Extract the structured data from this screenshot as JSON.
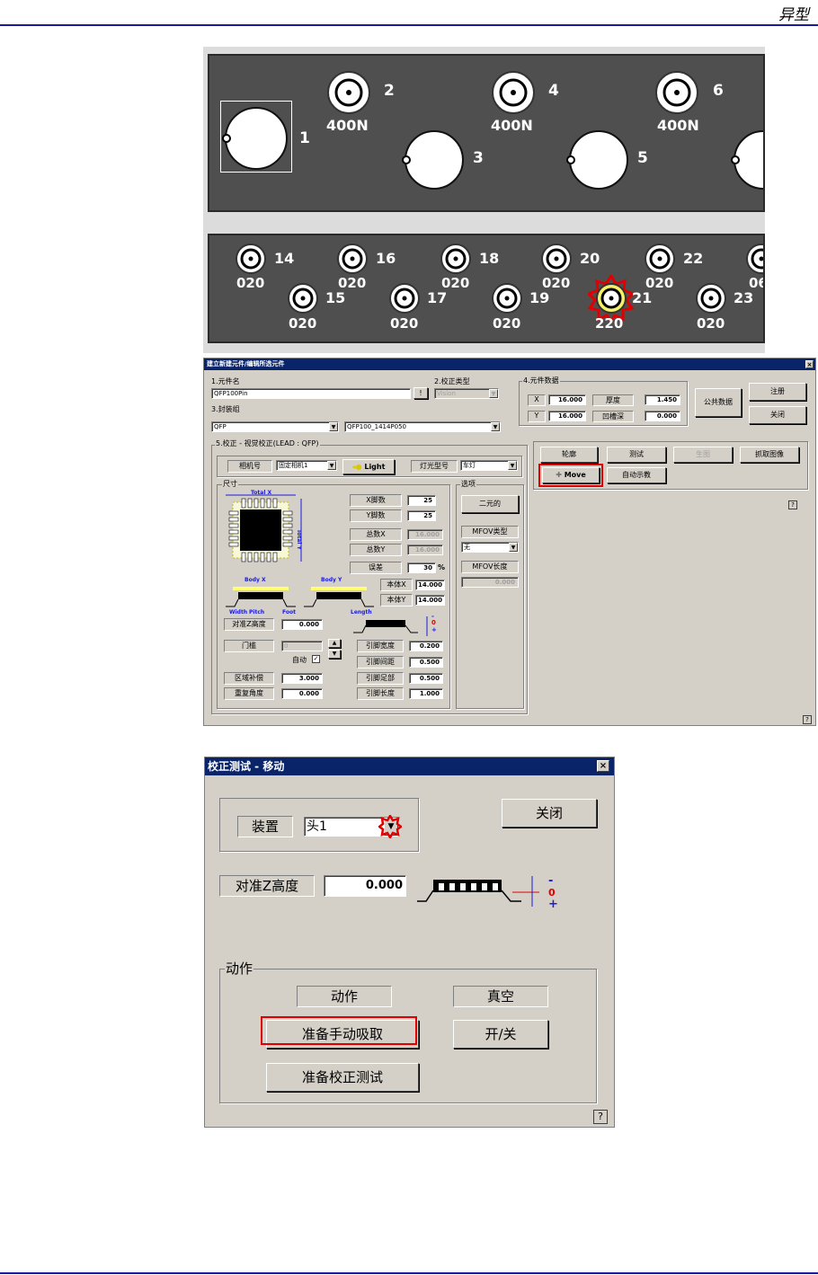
{
  "page_header": {
    "title": "异型"
  },
  "nozzles_top": [
    {
      "num": "1",
      "type": ""
    },
    {
      "num": "2",
      "type": "400N"
    },
    {
      "num": "3",
      "type": ""
    },
    {
      "num": "4",
      "type": "400N"
    },
    {
      "num": "5",
      "type": ""
    },
    {
      "num": "6",
      "type": "400N"
    }
  ],
  "nozzles_bottom": [
    {
      "num": "14",
      "type": "020"
    },
    {
      "num": "15",
      "type": "020"
    },
    {
      "num": "16",
      "type": "020"
    },
    {
      "num": "17",
      "type": "020"
    },
    {
      "num": "18",
      "type": "020"
    },
    {
      "num": "19",
      "type": "020"
    },
    {
      "num": "20",
      "type": "020"
    },
    {
      "num": "21",
      "type": "220"
    },
    {
      "num": "22",
      "type": "020"
    },
    {
      "num": "23",
      "type": "020"
    },
    {
      "num": "06",
      "type": ""
    }
  ],
  "dialog1": {
    "title": "建立新建元件/编辑所选元件",
    "part_name_label": "1.元件名",
    "part_name_value": "QFP100Pin",
    "calib_type_label": "2.校正类型",
    "calib_type_value": "Vision",
    "pkg_group_label": "3.封装组",
    "pkg_group_value": "QFP",
    "pkg_name_value": "QFP100_1414P050",
    "part_data_label": "4.元件数据",
    "x_label": "X",
    "x_value": "16.000",
    "y_label": "Y",
    "y_value": "16.000",
    "thickness_label": "厚度",
    "thickness_value": "1.450",
    "groove_label": "凹槽深",
    "groove_value": "0.000",
    "common_data_btn": "公共数据",
    "register_btn": "注册",
    "close_btn": "关闭",
    "calib_group_label": "5.校正 - 视觉校正(LEAD : QFP)",
    "camera_label": "相机号",
    "camera_value": "固定相机1",
    "light_btn": "Light",
    "lamp_label": "灯光型号",
    "lamp_value": "车灯",
    "size_label": "尺寸",
    "total_x": "Total X",
    "total_y": "Total Y",
    "body_x": "Body X",
    "body_y": "Body Y",
    "width_lbl": "Width",
    "pitch_lbl": "Pitch",
    "foot_lbl": "Foot",
    "length_lbl": "Length",
    "x_pins_label": "X脚数",
    "x_pins_value": "25",
    "y_pins_label": "Y脚数",
    "y_pins_value": "25",
    "total_x_label": "总数X",
    "total_x_value": "16.000",
    "total_y_label": "总数Y",
    "total_y_value": "16.000",
    "error_label": "误差",
    "error_value": "30",
    "error_unit": "%",
    "body_x_label": "本体X",
    "body_x_value": "14.000",
    "body_y_label": "本体Y",
    "body_y_value": "14.000",
    "align_z_label": "对准Z高度",
    "align_z_value": "0.000",
    "threshold_label": "门槛",
    "threshold_value": "0",
    "auto_label": "自动",
    "region_comp_label": "区域补偿",
    "region_comp_value": "3.000",
    "repeat_angle_label": "重复角度",
    "repeat_angle_value": "0.000",
    "lead_width_label": "引脚宽度",
    "lead_width_value": "0.200",
    "lead_pitch_label": "引脚间距",
    "lead_pitch_value": "0.500",
    "lead_foot_label": "引脚足部",
    "lead_foot_value": "0.500",
    "lead_len_label": "引脚长度",
    "lead_len_value": "1.000",
    "options_label": "选项",
    "twod_btn": "二元的",
    "mfov_type_label": "MFOV类型",
    "mfov_type_value": "无",
    "mfov_len_label": "MFOV长度",
    "mfov_len_value": "0.000",
    "outline_btn": "轮廓",
    "test_btn": "测试",
    "generate_btn": "生图",
    "capture_btn": "抓取图像",
    "move_btn": "Move",
    "auto_teach_btn": "自动示教",
    "help": "?",
    "z_minus": "-",
    "z_zero": "0",
    "z_plus": "+"
  },
  "dialog2": {
    "title": "校正测试 - 移动",
    "device_label": "装置",
    "device_value": "头1",
    "close_btn": "关闭",
    "align_z_label": "对准Z高度",
    "align_z_value": "0.000",
    "z_minus": "-",
    "z_zero": "0",
    "z_plus": "+",
    "action_group": "动作",
    "action_label": "动作",
    "vacuum_label": "真空",
    "prep_pick_btn": "准备手动吸取",
    "onoff_btn": "开/关",
    "prep_test_btn": "准备校正测试",
    "help": "?"
  },
  "colors": {
    "highlight_red": "#e00000",
    "title_blue": "#0a246a",
    "dialog_gray": "#d4d0c8",
    "panel_dark": "#4f4f4f"
  }
}
